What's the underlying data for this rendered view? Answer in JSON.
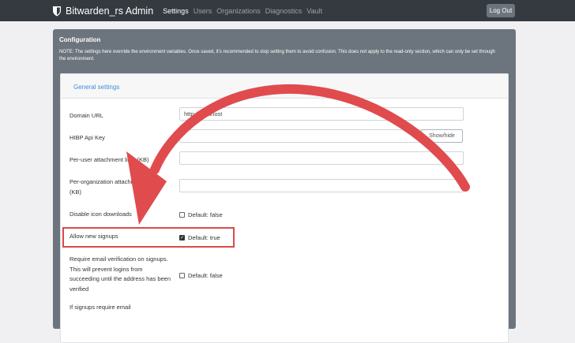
{
  "navbar": {
    "brand": "Bitwarden_rs Admin",
    "links": [
      "Settings",
      "Users",
      "Organizations",
      "Diagnostics",
      "Vault"
    ],
    "logout_label": "Log Out"
  },
  "config": {
    "title": "Configuration",
    "note": "NOTE: The settings here override the environment variables. Once saved, it's recommended to stop setting them to avoid confusion. This does not apply to the read-only section, which can only be set through the environment."
  },
  "general": {
    "header": "General settings",
    "domain_url": {
      "label": "Domain URL",
      "value": "http://localhost"
    },
    "hibp": {
      "label": "HIBP Api Key",
      "value": "",
      "button": "Show/hide"
    },
    "per_user": {
      "label": "Per-user attachment limit (KB)",
      "value": ""
    },
    "per_org": {
      "label": "Per-organization attachment limit (KB)",
      "value": ""
    },
    "disable_icon": {
      "label": "Disable icon downloads",
      "default": "Default: false",
      "checked": false
    },
    "allow_signups": {
      "label": "Allow new signups",
      "default": "Default: true",
      "checked": true
    },
    "require_verify": {
      "label": "Require email verification on signups. This will prevent logins from succeeding until the address has been verified",
      "default": "Default: false",
      "checked": false
    },
    "if_signups": {
      "label": "If signups require email"
    }
  },
  "colors": {
    "navbar": "#343a40",
    "card": "#6c757d",
    "link": "#3b8ed8",
    "annotation": "#e04b4e"
  }
}
